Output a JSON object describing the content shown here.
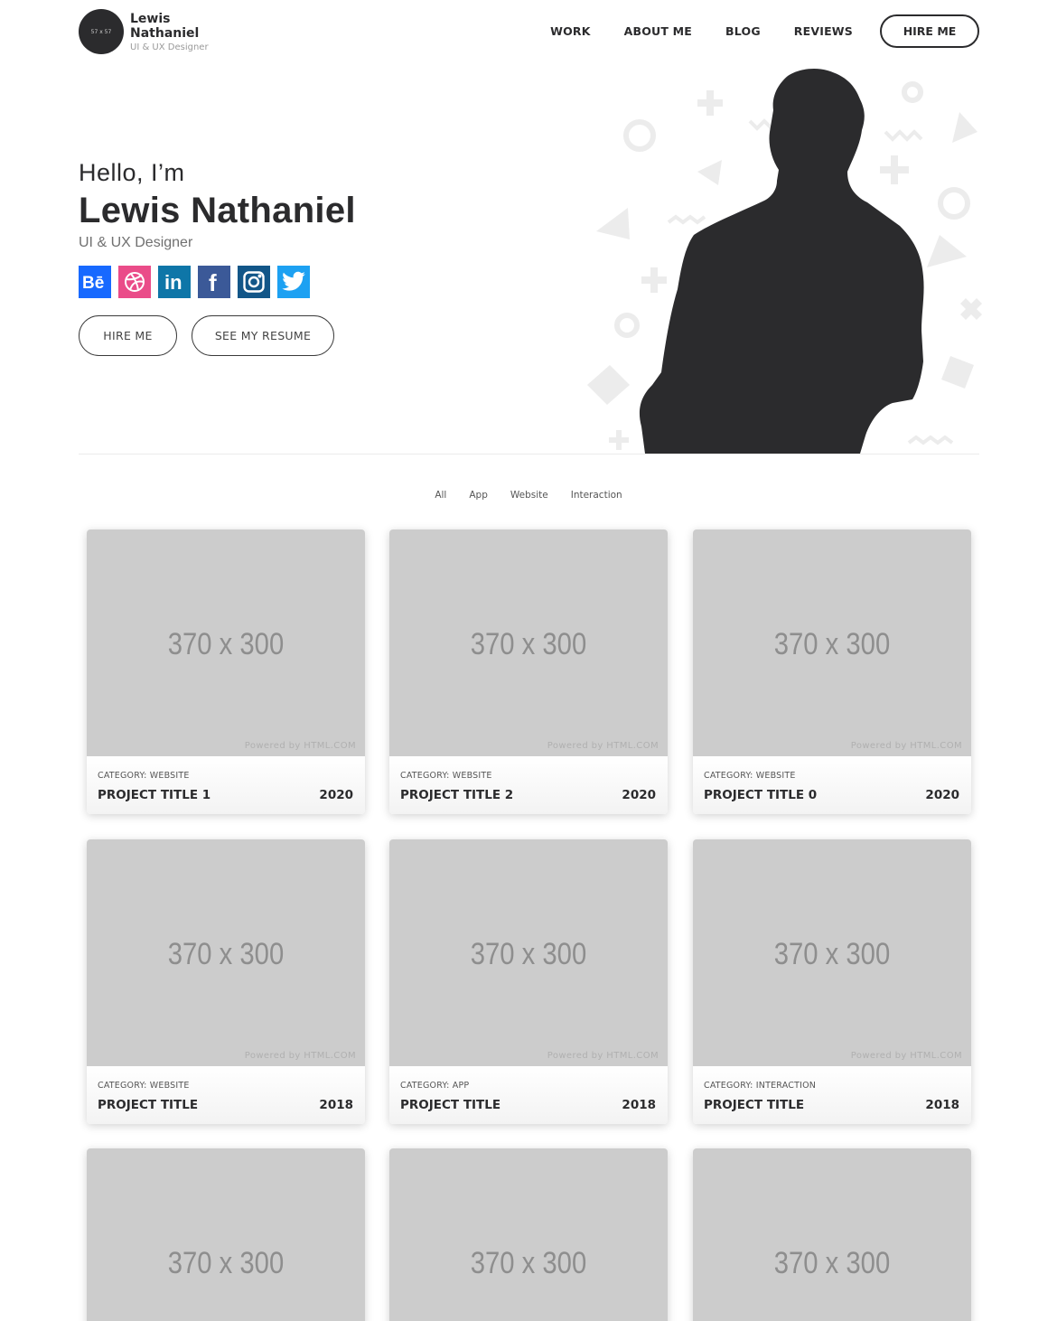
{
  "brand": {
    "avatar_text": "57 x 57",
    "name": "Lewis Nathaniel",
    "role": "UI & UX Designer"
  },
  "nav": {
    "items": [
      "WORK",
      "ABOUT ME",
      "BLOG",
      "REVIEWS"
    ],
    "hire_label": "HIRE ME"
  },
  "hero": {
    "greeting": "Hello, I’m",
    "name": "Lewis Nathaniel",
    "role": "UI & UX Designer",
    "socials": [
      {
        "icon": "behance-icon",
        "color": "#1769ff"
      },
      {
        "icon": "dribbble-icon",
        "color": "#ea4c89"
      },
      {
        "icon": "linkedin-icon",
        "color": "#0e76a8"
      },
      {
        "icon": "facebook-icon",
        "color": "#3b5998"
      },
      {
        "icon": "instagram-icon",
        "color": "#125688"
      },
      {
        "icon": "twitter-icon",
        "color": "#1da1f2"
      }
    ],
    "hire_button": "HIRE ME",
    "resume_button": "SEE MY RESUME"
  },
  "filters": [
    "All",
    "App",
    "Website",
    "Interaction"
  ],
  "projects": [
    {
      "image_text": "370 x 300",
      "powered": "Powered by HTML.COM",
      "category": "CATEGORY: WEBSITE",
      "title": "PROJECT TITLE 1",
      "year": "2020"
    },
    {
      "image_text": "370 x 300",
      "powered": "Powered by HTML.COM",
      "category": "CATEGORY: WEBSITE",
      "title": "PROJECT TITLE 2",
      "year": "2020"
    },
    {
      "image_text": "370 x 300",
      "powered": "Powered by HTML.COM",
      "category": "CATEGORY: WEBSITE",
      "title": "PROJECT TITLE 0",
      "year": "2020"
    },
    {
      "image_text": "370 x 300",
      "powered": "Powered by HTML.COM",
      "category": "CATEGORY: WEBSITE",
      "title": "PROJECT TITLE",
      "year": "2018"
    },
    {
      "image_text": "370 x 300",
      "powered": "Powered by HTML.COM",
      "category": "CATEGORY: APP",
      "title": "PROJECT TITLE",
      "year": "2018"
    },
    {
      "image_text": "370 x 300",
      "powered": "Powered by HTML.COM",
      "category": "CATEGORY: INTERACTION",
      "title": "PROJECT TITLE",
      "year": "2018"
    },
    {
      "image_text": "370 x 300",
      "powered": "",
      "category": "",
      "title": "",
      "year": ""
    },
    {
      "image_text": "370 x 300",
      "powered": "",
      "category": "",
      "title": "",
      "year": ""
    },
    {
      "image_text": "370 x 300",
      "powered": "",
      "category": "",
      "title": "",
      "year": ""
    }
  ]
}
